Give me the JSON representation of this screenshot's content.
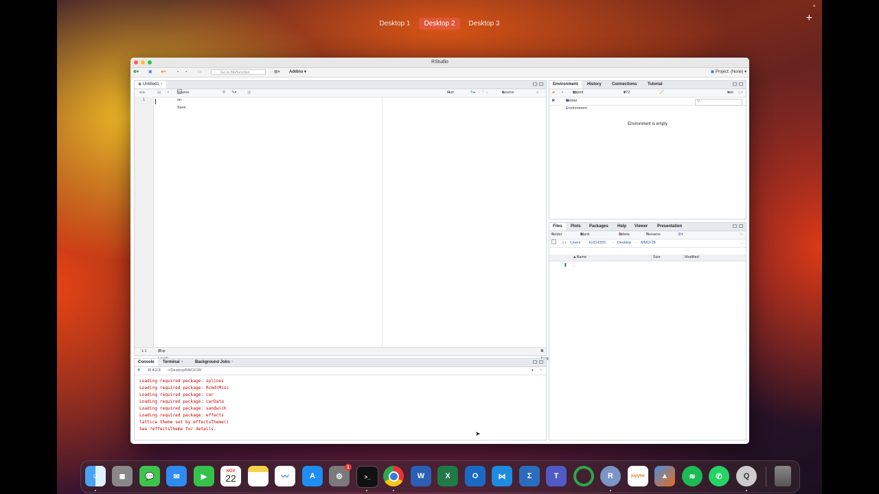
{
  "desktops": [
    "Desktop 1",
    "Desktop 2",
    "Desktop 3"
  ],
  "active_desktop": "Desktop 2",
  "window": {
    "title": "RStudio",
    "toolbar": {
      "goto_placeholder": "Go to file/function",
      "addins_label": "Addins",
      "project_label": "Project: (None)"
    }
  },
  "source": {
    "tab_label": "Untitled1",
    "source_on_save": "Source on Save",
    "run_label": "Run",
    "source_label": "Source",
    "line_number": "1",
    "cursor_pos": "1:1",
    "scope": "(Top Level)",
    "file_type": "R Script"
  },
  "console": {
    "tabs": [
      "Console",
      "Terminal",
      "Background Jobs"
    ],
    "version": "R 4.2.3",
    "path": "~/Desktop/MM1F28/",
    "lines": [
      "Loading required package: splines",
      "Loading required package: RcmdrMisc",
      "Loading required package: car",
      "Loading required package: carData",
      "Loading required package: sandwich",
      "Loading required package: effects",
      "lattice theme set by effectsTheme()",
      "See ?effectsTheme for details."
    ]
  },
  "environment": {
    "tabs": [
      "Environment",
      "History",
      "Connections",
      "Tutorial"
    ],
    "import_label": "Import Dataset",
    "memory": "372 MiB",
    "view_mode": "List",
    "language": "R",
    "scope": "Global Environment",
    "empty_text": "Environment is empty"
  },
  "files": {
    "tabs": [
      "Files",
      "Plots",
      "Packages",
      "Help",
      "Viewer",
      "Presentation"
    ],
    "actions": [
      "Folder",
      "Blank File",
      "Delete",
      "Rename"
    ],
    "breadcrumb": [
      "Users",
      "kv914393",
      "Desktop",
      "MM1F28"
    ],
    "columns": [
      "Name",
      "Size",
      "Modified"
    ],
    "up_entry": ".."
  },
  "dock": {
    "calendar_month": "NOV",
    "calendar_day": "22",
    "settings_badge": "1",
    "apps": [
      "finder",
      "launchpad",
      "messages",
      "mail",
      "facetime",
      "calendar",
      "notes",
      "freeform",
      "app-store",
      "system-settings",
      "terminal",
      "chrome",
      "word",
      "excel",
      "outlook",
      "vscode",
      "sigma",
      "teams",
      "circle",
      "r",
      "jupyter",
      "matlab",
      "spotify",
      "whatsapp",
      "quicktime",
      "trash"
    ]
  }
}
